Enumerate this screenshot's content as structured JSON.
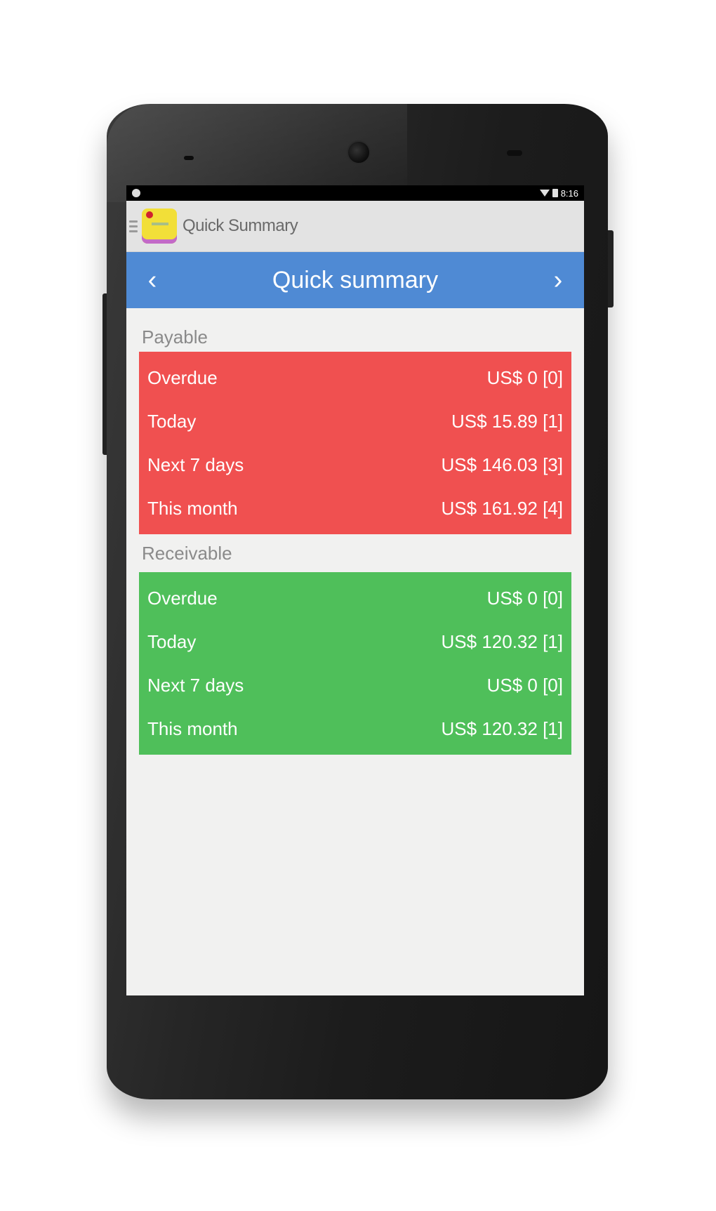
{
  "status_bar": {
    "time": "8:16"
  },
  "action_bar": {
    "menu_icon": "hamburger-icon",
    "app_icon": "app-logo",
    "title": "Quick Summary"
  },
  "nav": {
    "prev_icon": "chevron-left-icon",
    "prev_label": "‹",
    "title": "Quick summary",
    "next_icon": "chevron-right-icon",
    "next_label": "›"
  },
  "payable": {
    "label": "Payable",
    "color": "#f05050",
    "rows": [
      {
        "label": "Overdue",
        "value": "US$ 0 [0]"
      },
      {
        "label": "Today",
        "value": "US$ 15.89 [1]"
      },
      {
        "label": "Next 7 days",
        "value": "US$ 146.03 [3]"
      },
      {
        "label": "This month",
        "value": "US$ 161.92 [4]"
      }
    ]
  },
  "receivable": {
    "label": "Receivable",
    "color": "#4fbf5a",
    "rows": [
      {
        "label": "Overdue",
        "value": "US$ 0 [0]"
      },
      {
        "label": "Today",
        "value": "US$ 120.32 [1]"
      },
      {
        "label": "Next 7 days",
        "value": "US$ 0 [0]"
      },
      {
        "label": "This month",
        "value": "US$ 120.32 [1]"
      }
    ]
  },
  "colors": {
    "nav_bar": "#4f8ad4",
    "screen_background": "#f1f1f0",
    "action_bar": "#e3e3e3"
  }
}
